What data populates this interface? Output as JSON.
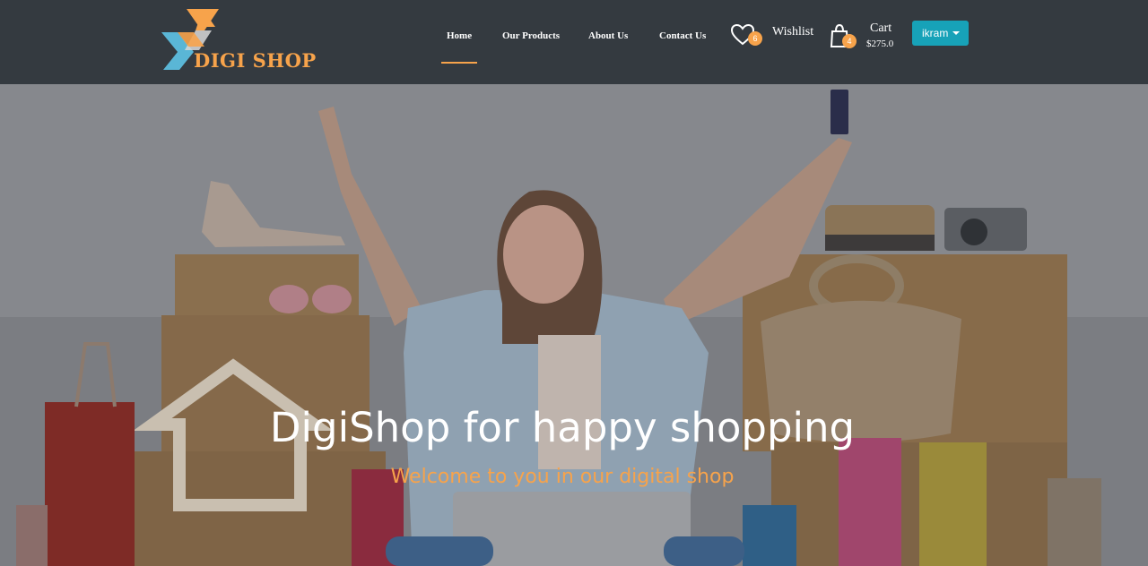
{
  "brand": {
    "name": "DIGI SHOP",
    "accent": "#f7a34b",
    "logo_blue": "#5ab6d6"
  },
  "nav": {
    "items": [
      {
        "label": "Home",
        "active": true
      },
      {
        "label": "Our Products",
        "active": false
      },
      {
        "label": "About Us",
        "active": false
      },
      {
        "label": "Contact Us",
        "active": false
      }
    ]
  },
  "wishlist": {
    "label": "Wishlist",
    "count": "6",
    "icon": "heart-icon"
  },
  "cart": {
    "label": "Cart",
    "count": "4",
    "total": "$275.0",
    "icon": "shopping-bag-icon"
  },
  "user": {
    "name": "ikram",
    "color": "#17a2b8"
  },
  "hero": {
    "title": "DigiShop for happy shopping",
    "subtitle": "Welcome to you in our digital shop"
  }
}
